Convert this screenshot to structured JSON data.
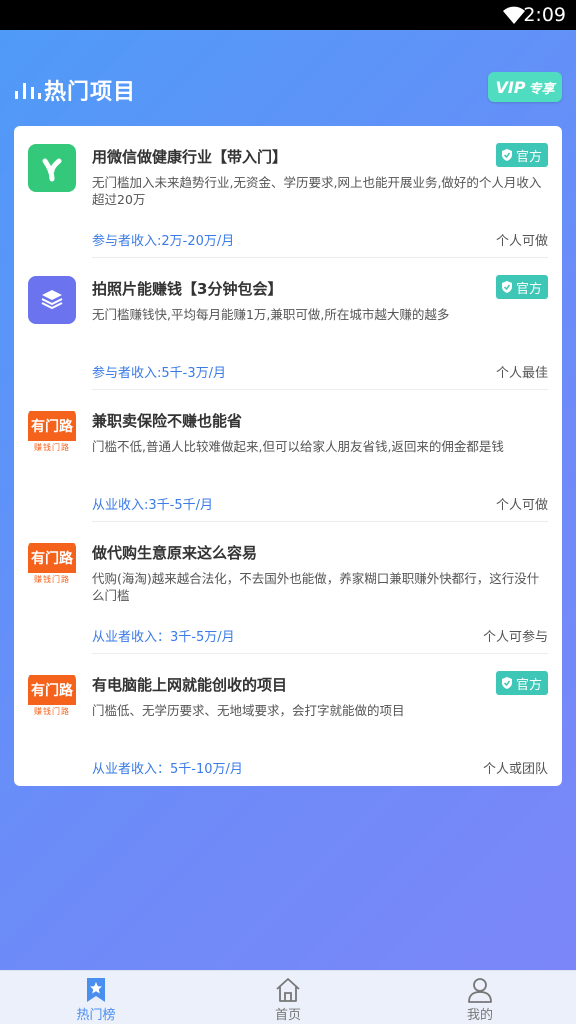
{
  "status_bar": {
    "time": "2:09",
    "wifi_icon": "wifi-icon"
  },
  "header": {
    "title": "热门项目",
    "vip_label": "VIP",
    "vip_suffix": "专享"
  },
  "projects": [
    {
      "title": "用微信做健康行业【带入门】",
      "description": "无门槛加入未来趋势行业,无资金、学历要求,网上也能开展业务,做好的个人月收入超过20万",
      "income": "参与者收入:2万-20万/月",
      "suitable": "个人可做",
      "official": "官方",
      "logo": "green-y-logo"
    },
    {
      "title": "拍照片能赚钱【3分钟包会】",
      "description": "无门槛赚钱快,平均每月能赚1万,兼职可做,所在城市越大赚的越多",
      "income": "参与者收入:5千-3万/月",
      "suitable": "个人最佳",
      "official": "官方",
      "logo": "purple-layers-logo"
    },
    {
      "title": "兼职卖保险不赚也能省",
      "description": "门槛不低,普通人比较难做起来,但可以给家人朋友省钱,返回来的佣金都是钱",
      "income": "从业收入:3千-5千/月",
      "suitable": "个人可做",
      "official": "",
      "logo": "orange-youmenlu-logo",
      "logo_top": "有门路",
      "logo_bottom": "赚钱门路"
    },
    {
      "title": "做代购生意原来这么容易",
      "description": "代购(海淘)越来越合法化，不去国外也能做，养家糊口兼职赚外快都行，这行没什么门槛",
      "income": "从业者收入：3千-5万/月",
      "suitable": "个人可参与",
      "official": "",
      "logo": "orange-youmenlu-logo",
      "logo_top": "有门路",
      "logo_bottom": "赚钱门路"
    },
    {
      "title": "有电脑能上网就能创收的项目",
      "description": "门槛低、无学历要求、无地域要求，会打字就能做的项目",
      "income": "从业者收入：5千-10万/月",
      "suitable": "个人或团队",
      "official": "官方",
      "logo": "orange-youmenlu-logo",
      "logo_top": "有门路",
      "logo_bottom": "赚钱门路"
    }
  ],
  "tabbar": {
    "tabs": [
      {
        "label": "热门榜",
        "icon": "star-bookmark-icon",
        "active": true
      },
      {
        "label": "首页",
        "icon": "home-icon",
        "active": false
      },
      {
        "label": "我的",
        "icon": "person-icon",
        "active": false
      }
    ],
    "active_color": "#4a8ef0",
    "inactive_color": "#777777"
  }
}
